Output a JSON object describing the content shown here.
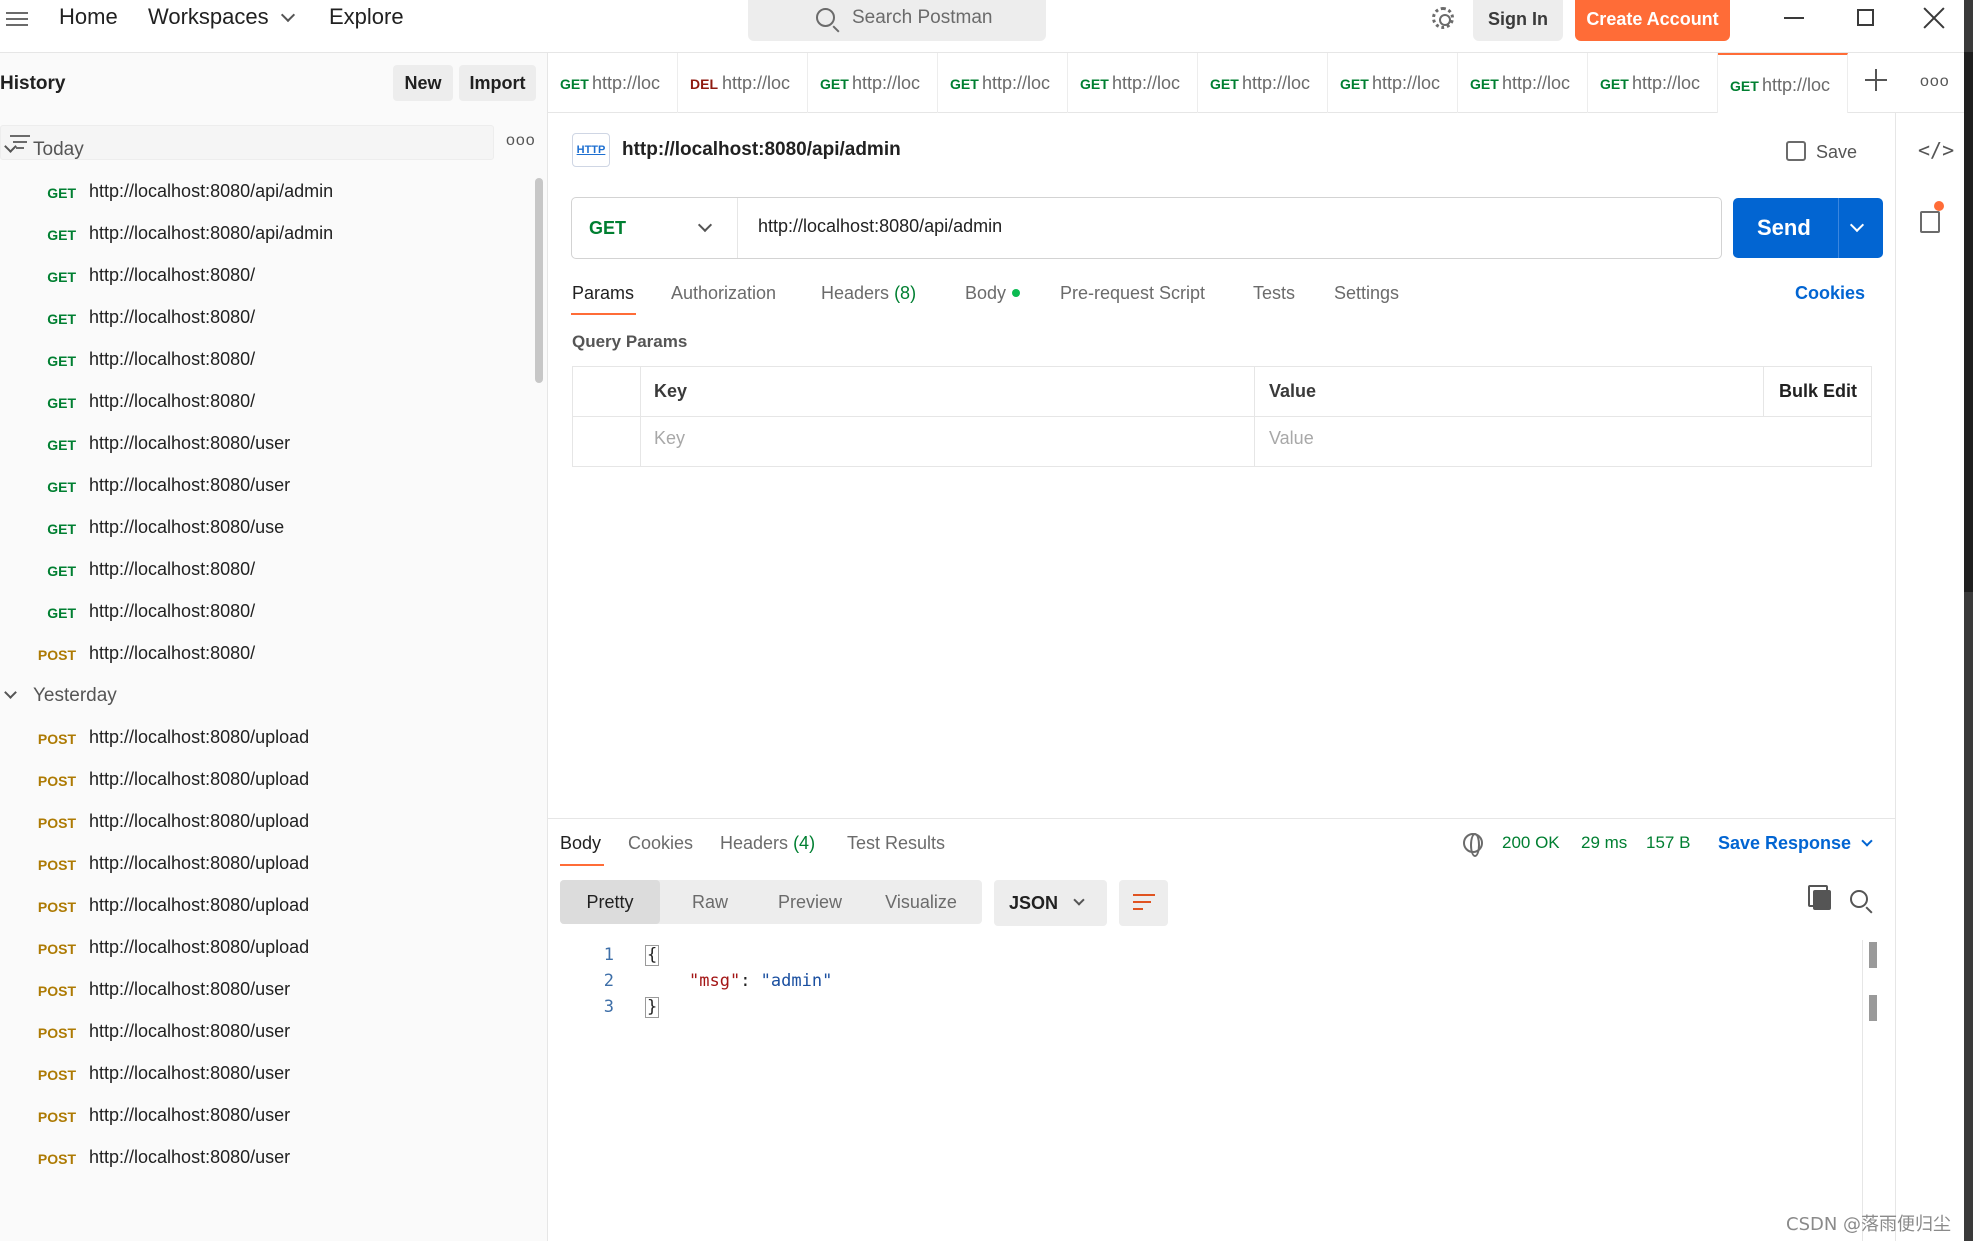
{
  "nav": {
    "home": "Home",
    "workspaces": "Workspaces",
    "explore": "Explore",
    "search_placeholder": "Search Postman",
    "sign_in": "Sign In",
    "create_account": "Create Account"
  },
  "sidebar": {
    "title": "History",
    "new_label": "New",
    "import_label": "Import",
    "groups": [
      {
        "label": "Today",
        "items": [
          {
            "method": "GET",
            "url": "http://localhost:8080/api/admin"
          },
          {
            "method": "GET",
            "url": "http://localhost:8080/api/admin"
          },
          {
            "method": "GET",
            "url": "http://localhost:8080/"
          },
          {
            "method": "GET",
            "url": "http://localhost:8080/"
          },
          {
            "method": "GET",
            "url": "http://localhost:8080/"
          },
          {
            "method": "GET",
            "url": "http://localhost:8080/"
          },
          {
            "method": "GET",
            "url": "http://localhost:8080/user"
          },
          {
            "method": "GET",
            "url": "http://localhost:8080/user"
          },
          {
            "method": "GET",
            "url": "http://localhost:8080/use"
          },
          {
            "method": "GET",
            "url": "http://localhost:8080/"
          },
          {
            "method": "GET",
            "url": "http://localhost:8080/"
          },
          {
            "method": "POST",
            "url": "http://localhost:8080/"
          }
        ]
      },
      {
        "label": "Yesterday",
        "items": [
          {
            "method": "POST",
            "url": "http://localhost:8080/upload"
          },
          {
            "method": "POST",
            "url": "http://localhost:8080/upload"
          },
          {
            "method": "POST",
            "url": "http://localhost:8080/upload"
          },
          {
            "method": "POST",
            "url": "http://localhost:8080/upload"
          },
          {
            "method": "POST",
            "url": "http://localhost:8080/upload"
          },
          {
            "method": "POST",
            "url": "http://localhost:8080/upload"
          },
          {
            "method": "POST",
            "url": "http://localhost:8080/user"
          },
          {
            "method": "POST",
            "url": "http://localhost:8080/user"
          },
          {
            "method": "POST",
            "url": "http://localhost:8080/user"
          },
          {
            "method": "POST",
            "url": "http://localhost:8080/user"
          },
          {
            "method": "POST",
            "url": "http://localhost:8080/user"
          }
        ]
      }
    ]
  },
  "tabs": [
    {
      "method": "GET",
      "label": "http://loc"
    },
    {
      "method": "DEL",
      "label": "http://loc"
    },
    {
      "method": "GET",
      "label": "http://loc"
    },
    {
      "method": "GET",
      "label": "http://loc"
    },
    {
      "method": "GET",
      "label": "http://loc"
    },
    {
      "method": "GET",
      "label": "http://loc"
    },
    {
      "method": "GET",
      "label": "http://loc"
    },
    {
      "method": "GET",
      "label": "http://loc"
    },
    {
      "method": "GET",
      "label": "http://loc"
    },
    {
      "method": "GET",
      "label": "http://loc"
    }
  ],
  "request": {
    "icon_text": "HTTP",
    "title": "http://localhost:8080/api/admin",
    "save_label": "Save",
    "method": "GET",
    "url": "http://localhost:8080/api/admin",
    "send_label": "Send",
    "tabs": {
      "params": "Params",
      "authorization": "Authorization",
      "headers": "Headers",
      "headers_count": "(8)",
      "body": "Body",
      "pre_request": "Pre-request Script",
      "tests": "Tests",
      "settings": "Settings"
    },
    "cookies_label": "Cookies",
    "query_params_title": "Query Params",
    "table": {
      "key_header": "Key",
      "value_header": "Value",
      "bulk_edit": "Bulk Edit",
      "key_placeholder": "Key",
      "value_placeholder": "Value"
    }
  },
  "response": {
    "tabs": {
      "body": "Body",
      "cookies": "Cookies",
      "headers": "Headers",
      "headers_count": "(4)",
      "test_results": "Test Results"
    },
    "status": "200 OK",
    "time": "29 ms",
    "size": "157 B",
    "save_response": "Save Response",
    "views": {
      "pretty": "Pretty",
      "raw": "Raw",
      "preview": "Preview",
      "visualize": "Visualize"
    },
    "format": "JSON",
    "code": {
      "line_numbers": [
        "1",
        "2",
        "3"
      ],
      "open_brace": "{",
      "key": "\"msg\"",
      "colon": ": ",
      "value": "\"admin\"",
      "close_brace": "}"
    }
  },
  "watermark": "CSDN @落雨便归尘",
  "colors": {
    "accent": "#ff6c37",
    "send": "#0265d2",
    "get": "#007f31",
    "post": "#ad7a03",
    "delete": "#8e1a10"
  }
}
